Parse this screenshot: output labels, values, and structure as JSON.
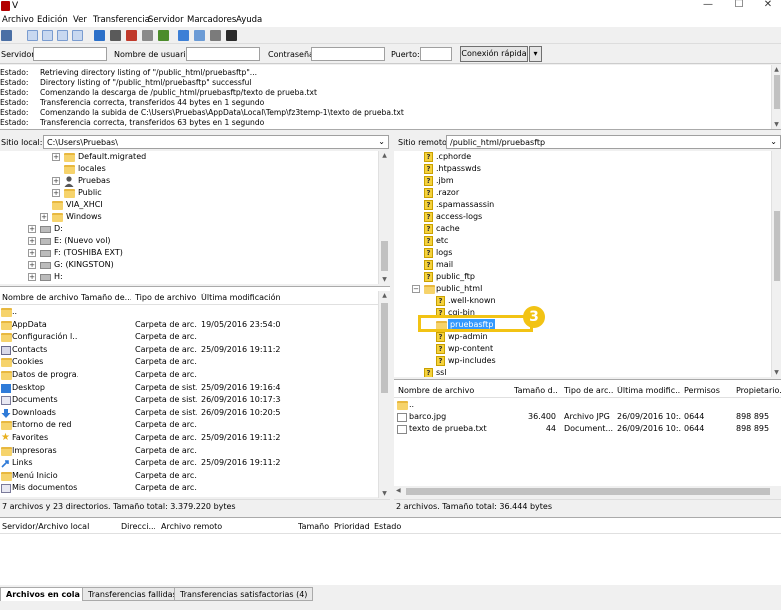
{
  "window": {
    "title": "V",
    "controls": [
      "—",
      "☐",
      "✕"
    ]
  },
  "menu": [
    "Archivo",
    "Edición",
    "Ver",
    "Transferencia",
    "Servidor",
    "Marcadores",
    "Ayuda"
  ],
  "quickconnect": {
    "host_label": "Servidor:",
    "user_label": "Nombre de usuario:",
    "pass_label": "Contraseña:",
    "port_label": "Puerto:",
    "connect_label": "Conexión rápida",
    "dropdown_arrow": "▾"
  },
  "log": [
    {
      "k": "Estado:",
      "v": "Retrieving directory listing of \"/public_html/pruebasftp\"..."
    },
    {
      "k": "Estado:",
      "v": "Directory listing of \"/public_html/pruebasftp\" successful"
    },
    {
      "k": "Estado:",
      "v": "Comenzando la descarga de /public_html/pruebasftp/texto de prueba.txt"
    },
    {
      "k": "Estado:",
      "v": "Transferencia correcta, transferidos 44 bytes en 1 segundo"
    },
    {
      "k": "Estado:",
      "v": "Comenzando la subida de C:\\Users\\Pruebas\\AppData\\Local\\Temp\\fz3temp-1\\texto de prueba.txt"
    },
    {
      "k": "Estado:",
      "v": "Transferencia correcta, transferidos 63 bytes en 1 segundo"
    }
  ],
  "local": {
    "site_label": "Sitio local:",
    "path": "C:\\Users\\Pruebas\\",
    "tree": [
      {
        "label": "Default.migrated",
        "icon": "folder",
        "exp": "+",
        "indent": 1
      },
      {
        "label": "locales",
        "icon": "folder",
        "exp": "",
        "indent": 1
      },
      {
        "label": "Pruebas",
        "icon": "person",
        "exp": "+",
        "indent": 1
      },
      {
        "label": "Public",
        "icon": "folder",
        "exp": "+",
        "indent": 1
      },
      {
        "label": "VIA_XHCI",
        "icon": "folder",
        "exp": "",
        "indent": 0
      },
      {
        "label": "Windows",
        "icon": "folder",
        "exp": "+",
        "indent": 0
      },
      {
        "label": "D:",
        "icon": "drive",
        "exp": "+",
        "indent": -1
      },
      {
        "label": "E: (Nuevo vol)",
        "icon": "drive",
        "exp": "+",
        "indent": -1
      },
      {
        "label": "F: (TOSHIBA EXT)",
        "icon": "drive",
        "exp": "+",
        "indent": -1
      },
      {
        "label": "G: (KINGSTON)",
        "icon": "drive",
        "exp": "+",
        "indent": -1
      },
      {
        "label": "H:",
        "icon": "drive",
        "exp": "+",
        "indent": -1
      }
    ],
    "columns": [
      "Nombre de archivo",
      "Tamaño de...",
      "Tipo de archivo",
      "Última modificación"
    ],
    "files": [
      {
        "name": "..",
        "type": "",
        "date": "",
        "icon": "folder"
      },
      {
        "name": "AppData",
        "type": "Carpeta de arc...",
        "date": "19/05/2016 23:54:06",
        "icon": "folder"
      },
      {
        "name": "Configuración l...",
        "type": "Carpeta de arc...",
        "date": "",
        "icon": "folder"
      },
      {
        "name": "Contacts",
        "type": "Carpeta de arc...",
        "date": "25/09/2016 19:11:23",
        "icon": "contacts"
      },
      {
        "name": "Cookies",
        "type": "Carpeta de arc...",
        "date": "",
        "icon": "folder"
      },
      {
        "name": "Datos de progra...",
        "type": "Carpeta de arc...",
        "date": "",
        "icon": "folder"
      },
      {
        "name": "Desktop",
        "type": "Carpeta de sist...",
        "date": "25/09/2016 19:16:48",
        "icon": "desktop"
      },
      {
        "name": "Documents",
        "type": "Carpeta de sist...",
        "date": "26/09/2016 10:17:34",
        "icon": "documents"
      },
      {
        "name": "Downloads",
        "type": "Carpeta de sist...",
        "date": "26/09/2016 10:20:59",
        "icon": "download"
      },
      {
        "name": "Entorno de red",
        "type": "Carpeta de arc...",
        "date": "",
        "icon": "folder"
      },
      {
        "name": "Favorites",
        "type": "Carpeta de arc...",
        "date": "25/09/2016 19:11:23",
        "icon": "star"
      },
      {
        "name": "Impresoras",
        "type": "Carpeta de arc...",
        "date": "",
        "icon": "folder"
      },
      {
        "name": "Links",
        "type": "Carpeta de arc...",
        "date": "25/09/2016 19:11:23",
        "icon": "links"
      },
      {
        "name": "Menú Inicio",
        "type": "Carpeta de arc...",
        "date": "",
        "icon": "folder"
      },
      {
        "name": "Mis documentos",
        "type": "Carpeta de arc...",
        "date": "",
        "icon": "documents"
      }
    ],
    "status": "7 archivos y 23 directorios. Tamaño total: 3.379.220 bytes"
  },
  "remote": {
    "site_label": "Sitio remoto:",
    "path": "/public_html/pruebasftp",
    "tree": [
      {
        "label": ".cphorde",
        "icon": "q",
        "indent": 0
      },
      {
        "label": ".htpasswds",
        "icon": "q",
        "indent": 0
      },
      {
        "label": ".jbm",
        "icon": "q",
        "indent": 0
      },
      {
        "label": ".razor",
        "icon": "q",
        "indent": 0
      },
      {
        "label": ".spamassassin",
        "icon": "q",
        "indent": 0
      },
      {
        "label": "access-logs",
        "icon": "q",
        "indent": 0
      },
      {
        "label": "cache",
        "icon": "q",
        "indent": 0
      },
      {
        "label": "etc",
        "icon": "q",
        "indent": 0
      },
      {
        "label": "logs",
        "icon": "q",
        "indent": 0
      },
      {
        "label": "mail",
        "icon": "q",
        "indent": 0
      },
      {
        "label": "public_ftp",
        "icon": "q",
        "indent": 0
      },
      {
        "label": "public_html",
        "icon": "folder",
        "exp": "−",
        "indent": 0
      },
      {
        "label": ".well-known",
        "icon": "q",
        "indent": 1
      },
      {
        "label": "cgi-bin",
        "icon": "q",
        "indent": 1
      },
      {
        "label": "pruebasftp",
        "icon": "folder",
        "indent": 1,
        "selected": true
      },
      {
        "label": "wp-admin",
        "icon": "q",
        "indent": 1
      },
      {
        "label": "wp-content",
        "icon": "q",
        "indent": 1
      },
      {
        "label": "wp-includes",
        "icon": "q",
        "indent": 1
      },
      {
        "label": "ssl",
        "icon": "q",
        "indent": 0
      }
    ],
    "columns": [
      "Nombre de archivo",
      "Tamaño d...",
      "Tipo de arc...",
      "Última modific...",
      "Permisos",
      "Propietario..."
    ],
    "files": [
      {
        "name": "..",
        "size": "",
        "type": "",
        "date": "",
        "perm": "",
        "owner": "",
        "icon": "folder"
      },
      {
        "name": "barco.jpg",
        "size": "36.400",
        "type": "Archivo JPG",
        "date": "26/09/2016 10:...",
        "perm": "0644",
        "owner": "898 895",
        "icon": "image"
      },
      {
        "name": "texto de prueba.txt",
        "size": "44",
        "type": "Document...",
        "date": "26/09/2016 10:...",
        "perm": "0644",
        "owner": "898 895",
        "icon": "text"
      }
    ],
    "status": "2 archivos. Tamaño total: 36.444 bytes"
  },
  "queue": {
    "columns": [
      "Servidor/Archivo local",
      "Direcci...",
      "Archivo remoto",
      "Tamaño",
      "Prioridad",
      "Estado"
    ]
  },
  "tabs": [
    "Archivos en cola",
    "Transferencias fallidas",
    "Transferencias satisfactorias (4)"
  ],
  "annotation": {
    "marker": "3",
    "color": "#f2c314"
  }
}
